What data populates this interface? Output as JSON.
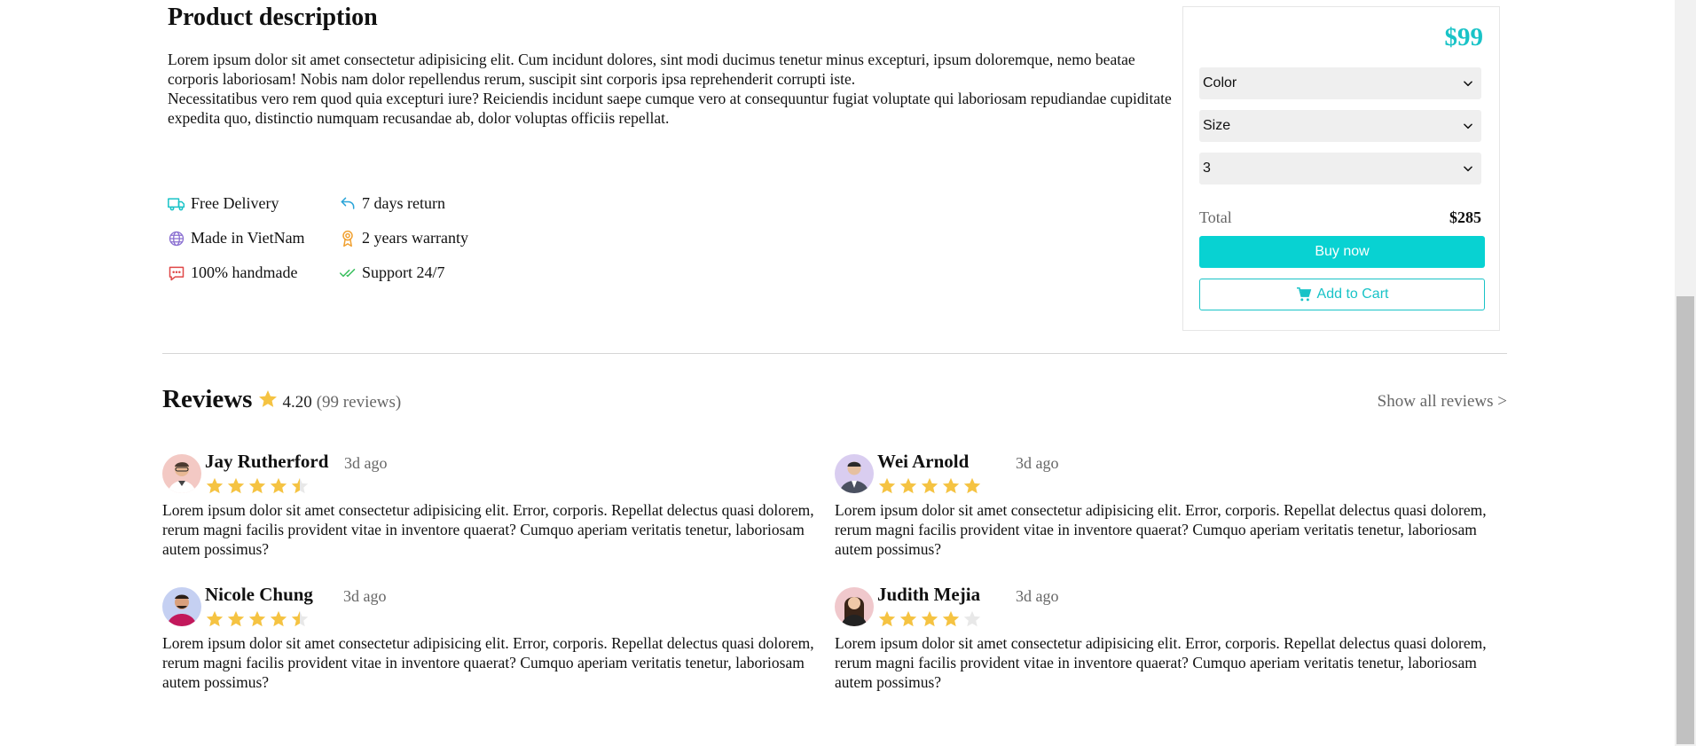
{
  "description": {
    "title": "Product description",
    "paragraph_1": "Lorem ipsum dolor sit amet consectetur adipisicing elit. Cum incidunt dolores, sint modi ducimus tenetur minus excepturi, ipsum doloremque, nemo beatae corporis laboriosam! Nobis nam dolor repellendus rerum, suscipit sint corporis ipsa reprehenderit corrupti iste.",
    "paragraph_2": "Necessitatibus vero rem quod quia excepturi iure? Reiciendis incidunt saepe cumque vero at consequuntur fugiat voluptate qui laboriosam repudiandae cupiditate expedita quo, distinctio numquam recusandae ab, dolor voluptas officiis repellat."
  },
  "features": [
    {
      "label": "Free Delivery",
      "icon": "truck-icon",
      "color": "#19c3c7"
    },
    {
      "label": "7 days return",
      "icon": "return-arrow-icon",
      "color": "#2aa4d8"
    },
    {
      "label": "Made in VietNam",
      "icon": "globe-icon",
      "color": "#8a6fd1"
    },
    {
      "label": "2 years warranty",
      "icon": "award-icon",
      "color": "#f0a030"
    },
    {
      "label": "100% handmade",
      "icon": "chat-icon",
      "color": "#e04848"
    },
    {
      "label": "Support 24/7",
      "icon": "double-check-icon",
      "color": "#3cc060"
    }
  ],
  "panel": {
    "price": "$99",
    "color_select": "Color",
    "size_select": "Size",
    "quantity_select": "3",
    "total_label": "Total",
    "total_value": "$285",
    "buy_label": "Buy now",
    "cart_label": "Add to Cart",
    "accent": "#08d2d2"
  },
  "reviews": {
    "title": "Reviews",
    "average": "4.20",
    "count": "(99 reviews)",
    "show_all": "Show all reviews >",
    "star_color": "#f5c342",
    "items": [
      {
        "name": "Jay Rutherford",
        "time": "3d ago",
        "rating": 4.5,
        "text": "Lorem ipsum dolor sit amet consectetur adipisicing elit. Error, corporis. Repellat delectus quasi dolorem, rerum magni facilis provident vitae in inventore quaerat? Cumquo aperiam veritatis tenetur, laboriosam autem possimus?"
      },
      {
        "name": "Wei Arnold",
        "time": "3d ago",
        "rating": 5,
        "text": "Lorem ipsum dolor sit amet consectetur adipisicing elit. Error, corporis. Repellat delectus quasi dolorem, rerum magni facilis provident vitae in inventore quaerat? Cumquo aperiam veritatis tenetur, laboriosam autem possimus?"
      },
      {
        "name": "Nicole Chung",
        "time": "3d ago",
        "rating": 4.5,
        "text": "Lorem ipsum dolor sit amet consectetur adipisicing elit. Error, corporis. Repellat delectus quasi dolorem, rerum magni facilis provident vitae in inventore quaerat? Cumquo aperiam veritatis tenetur, laboriosam autem possimus?"
      },
      {
        "name": "Judith Mejia",
        "time": "3d ago",
        "rating": 4,
        "text": "Lorem ipsum dolor sit amet consectetur adipisicing elit. Error, corporis. Repellat delectus quasi dolorem, rerum magni facilis provident vitae in inventore quaerat? Cumquo aperiam veritatis tenetur, laboriosam autem possimus?"
      }
    ]
  }
}
